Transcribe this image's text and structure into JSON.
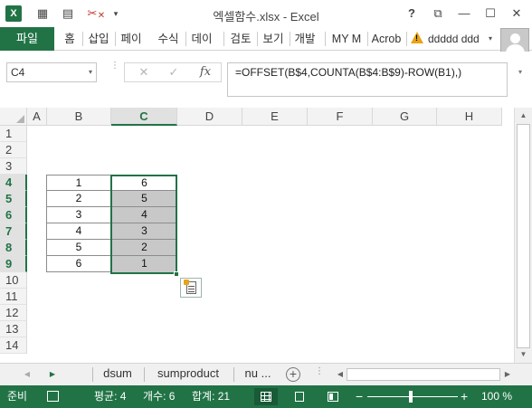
{
  "window": {
    "title": "엑셀함수.xlsx - Excel",
    "app_logo": "X",
    "help": "?",
    "controls": {
      "restore": "⧉",
      "minimize": "—",
      "maximize": "☐",
      "close": "✕"
    }
  },
  "quick_access": {
    "icons": [
      "save-icon",
      "print-preview-icon",
      "clear-format-icon",
      "clear-icon",
      "customize-icon"
    ],
    "glyphs": [
      "▦",
      "▤",
      "✂",
      "✕",
      "▾"
    ]
  },
  "ribbon": {
    "file_label": "파일",
    "tabs": [
      "홈",
      "삽입",
      "페이",
      "수식",
      "데이",
      "검토",
      "보기",
      "개발",
      "MY M",
      "Acrob"
    ],
    "user_name": "ddddd ddd",
    "user_caret": "▾"
  },
  "formula_bar": {
    "name_box": "C4",
    "name_caret": "▾",
    "cancel": "✕",
    "enter": "✓",
    "fx": "fx",
    "formula": "=OFFSET(B$4,COUNTA(B$4:B$9)-ROW(B1),)",
    "expand": "▾"
  },
  "grid": {
    "columns": [
      "A",
      "B",
      "C",
      "D",
      "E",
      "F",
      "G",
      "H"
    ],
    "rows": [
      "1",
      "2",
      "3",
      "4",
      "5",
      "6",
      "7",
      "8",
      "9",
      "10",
      "11",
      "12",
      "13",
      "14"
    ],
    "selected_column": "C",
    "selected_rows": [
      "4",
      "5",
      "6",
      "7",
      "8",
      "9"
    ],
    "column_b": [
      "1",
      "2",
      "3",
      "4",
      "5",
      "6"
    ],
    "column_c": [
      "6",
      "5",
      "4",
      "3",
      "2",
      "1"
    ],
    "colors": {
      "selection": "#217346",
      "filled": "#c8c8c8"
    }
  },
  "sheets": {
    "tabs": [
      "dsum",
      "sumproduct",
      "nu ..."
    ],
    "add": "+",
    "prev": "◀",
    "next": "▶",
    "scroll_left": "◀",
    "scroll_right": "▶"
  },
  "status": {
    "ready": "준비",
    "average": "평균: 4",
    "count": "개수: 6",
    "sum": "합계: 21",
    "zoom_minus": "−",
    "zoom_plus": "+",
    "zoom": "100 %",
    "zoom_level_percent": 100,
    "accent": "#217346"
  }
}
